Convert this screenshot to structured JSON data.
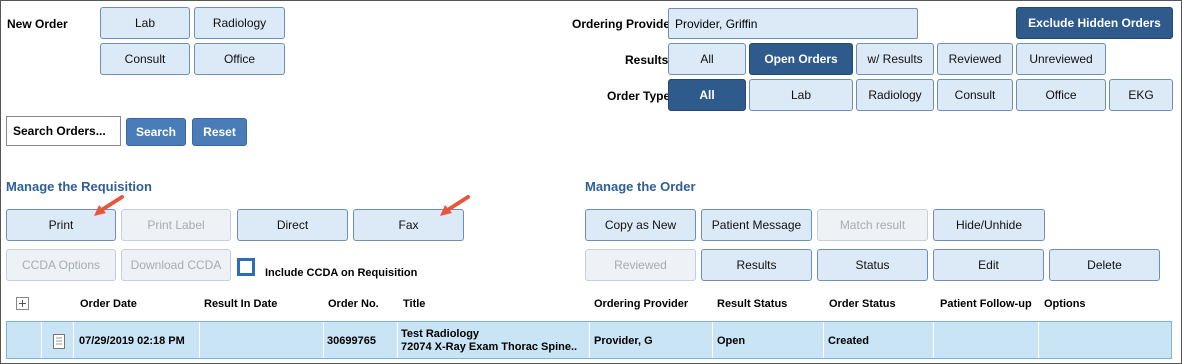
{
  "new_order": {
    "label": "New Order",
    "buttons": [
      "Lab",
      "Radiology",
      "Consult",
      "Office"
    ]
  },
  "ordering_provider": {
    "label": "Ordering Provider",
    "value": "Provider, Griffin"
  },
  "exclude_hidden": "Exclude Hidden Orders",
  "results": {
    "label": "Results",
    "options": [
      "All",
      "Open Orders",
      "w/ Results",
      "Reviewed",
      "Unreviewed"
    ],
    "selected": "Open Orders"
  },
  "order_type": {
    "label": "Order Type",
    "options": [
      "All",
      "Lab",
      "Radiology",
      "Consult",
      "Office",
      "EKG"
    ],
    "selected": "All"
  },
  "search": {
    "value": "Search Orders...",
    "search_label": "Search",
    "reset_label": "Reset"
  },
  "requisition": {
    "title": "Manage the Requisition",
    "print": "Print",
    "print_label": "Print Label",
    "direct": "Direct",
    "fax": "Fax",
    "ccda_options": "CCDA Options",
    "download_ccda": "Download CCDA",
    "include_ccda": "Include CCDA on Requisition"
  },
  "order": {
    "title": "Manage the Order",
    "copy_as_new": "Copy as New",
    "patient_message": "Patient Message",
    "match_result": "Match result",
    "hide_unhide": "Hide/Unhide",
    "reviewed": "Reviewed",
    "results": "Results",
    "status": "Status",
    "edit": "Edit",
    "delete": "Delete"
  },
  "table": {
    "headers": [
      "Order Date",
      "Result In Date",
      "Order No.",
      "Title",
      "Ordering Provider",
      "Result Status",
      "Order Status",
      "Patient Follow-up",
      "Options"
    ],
    "rows": [
      {
        "order_date": "07/29/2019 02:18 PM",
        "result_in_date": "",
        "order_no": "30699765",
        "title_line1": "Test Radiology",
        "title_line2": "72074 X-Ray Exam Thorac Spine..",
        "ordering_provider": "Provider, G",
        "result_status": "Open",
        "order_status": "Created",
        "patient_followup": "",
        "options": ""
      }
    ]
  },
  "colors": {
    "accent_dark": "#2e5a8c",
    "accent": "#4a7cb7",
    "button_bg": "#dce9f7",
    "section_title": "#2e5f99",
    "arrow": "#e8573d"
  }
}
